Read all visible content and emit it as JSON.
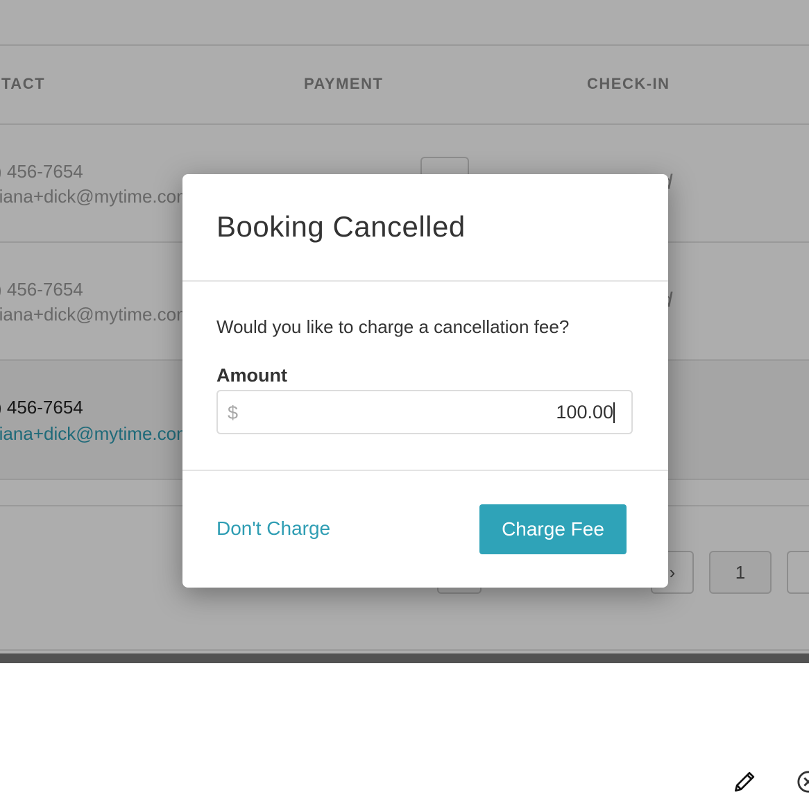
{
  "table": {
    "columns": [
      "TACT",
      "PAYMENT",
      "CHECK-IN"
    ],
    "rows": [
      {
        "phone": ") 456-7654",
        "email": "riana+dick@mytime.com"
      },
      {
        "phone": ") 456-7654",
        "email": "riana+dick@mytime.com"
      },
      {
        "phone": ") 456-7654",
        "email": "riana+dick@mytime.com"
      }
    ]
  },
  "pagination": {
    "current_page": "1"
  },
  "icons": {
    "edit": "pencil-icon",
    "cancel": "close-circle-icon"
  },
  "modal": {
    "title": "Booking Cancelled",
    "question": "Would you like to charge a cancellation fee?",
    "amount_label": "Amount",
    "currency_symbol": "$",
    "amount_value": "100.00",
    "dont_charge_label": "Don't Charge",
    "charge_label": "Charge Fee"
  },
  "colors": {
    "accent": "#2fa3b8",
    "link": "#2e9db3"
  }
}
